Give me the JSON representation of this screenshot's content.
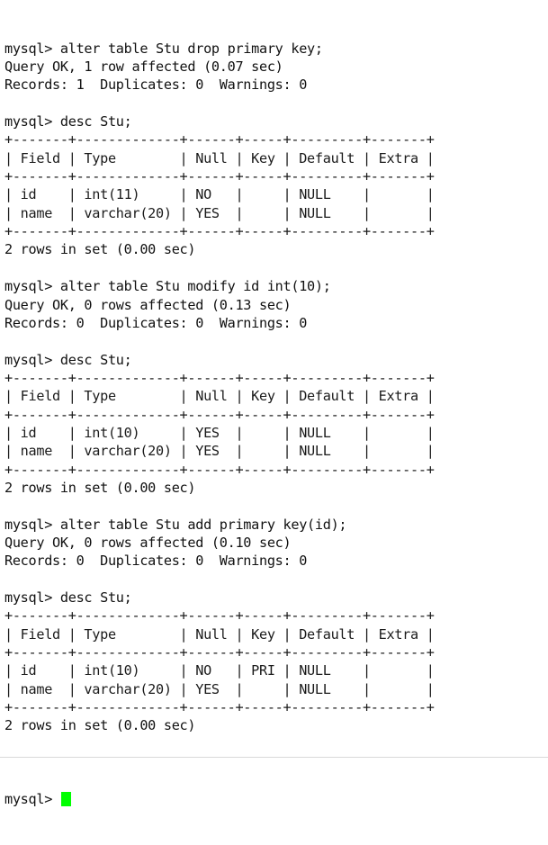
{
  "terminal": {
    "prompt": "mysql>",
    "cursor_color": "#00ff00",
    "background_color": "#ffffff",
    "text_color": "#111111",
    "lines": [
      "mysql> alter table Stu drop primary key;",
      "Query OK, 1 row affected (0.07 sec)",
      "Records: 1  Duplicates: 0  Warnings: 0",
      "",
      "mysql> desc Stu;",
      "+-------+-------------+------+-----+---------+-------+",
      "| Field | Type        | Null | Key | Default | Extra |",
      "+-------+-------------+------+-----+---------+-------+",
      "| id    | int(11)     | NO   |     | NULL    |       |",
      "| name  | varchar(20) | YES  |     | NULL    |       |",
      "+-------+-------------+------+-----+---------+-------+",
      "2 rows in set (0.00 sec)",
      "",
      "mysql> alter table Stu modify id int(10);",
      "Query OK, 0 rows affected (0.13 sec)",
      "Records: 0  Duplicates: 0  Warnings: 0",
      "",
      "mysql> desc Stu;",
      "+-------+-------------+------+-----+---------+-------+",
      "| Field | Type        | Null | Key | Default | Extra |",
      "+-------+-------------+------+-----+---------+-------+",
      "| id    | int(10)     | YES  |     | NULL    |       |",
      "| name  | varchar(20) | YES  |     | NULL    |       |",
      "+-------+-------------+------+-----+---------+-------+",
      "2 rows in set (0.00 sec)",
      "",
      "mysql> alter table Stu add primary key(id);",
      "Query OK, 0 rows affected (0.10 sec)",
      "Records: 0  Duplicates: 0  Warnings: 0",
      "",
      "mysql> desc Stu;",
      "+-------+-------------+------+-----+---------+-------+",
      "| Field | Type        | Null | Key | Default | Extra |",
      "+-------+-------------+------+-----+---------+-------+",
      "| id    | int(10)     | NO   | PRI | NULL    |       |",
      "| name  | varchar(20) | YES  |     | NULL    |       |",
      "+-------+-------------+------+-----+---------+-------+",
      "2 rows in set (0.00 sec)",
      ""
    ],
    "final_prompt": "mysql> "
  },
  "sessions": [
    {
      "command": "alter table Stu drop primary key;",
      "status": "Query OK, 1 row affected (0.07 sec)",
      "counters": "Records: 1  Duplicates: 0  Warnings: 0",
      "describe_command": "desc Stu;",
      "result_table": {
        "headers": [
          "Field",
          "Type",
          "Null",
          "Key",
          "Default",
          "Extra"
        ],
        "rows": [
          [
            "id",
            "int(11)",
            "NO",
            "",
            "NULL",
            ""
          ],
          [
            "name",
            "varchar(20)",
            "YES",
            "",
            "NULL",
            ""
          ]
        ],
        "footer": "2 rows in set (0.00 sec)"
      }
    },
    {
      "command": "alter table Stu modify id int(10);",
      "status": "Query OK, 0 rows affected (0.13 sec)",
      "counters": "Records: 0  Duplicates: 0  Warnings: 0",
      "describe_command": "desc Stu;",
      "result_table": {
        "headers": [
          "Field",
          "Type",
          "Null",
          "Key",
          "Default",
          "Extra"
        ],
        "rows": [
          [
            "id",
            "int(10)",
            "YES",
            "",
            "NULL",
            ""
          ],
          [
            "name",
            "varchar(20)",
            "YES",
            "",
            "NULL",
            ""
          ]
        ],
        "footer": "2 rows in set (0.00 sec)"
      }
    },
    {
      "command": "alter table Stu add primary key(id);",
      "status": "Query OK, 0 rows affected (0.10 sec)",
      "counters": "Records: 0  Duplicates: 0  Warnings: 0",
      "describe_command": "desc Stu;",
      "result_table": {
        "headers": [
          "Field",
          "Type",
          "Null",
          "Key",
          "Default",
          "Extra"
        ],
        "rows": [
          [
            "id",
            "int(10)",
            "NO",
            "PRI",
            "NULL",
            ""
          ],
          [
            "name",
            "varchar(20)",
            "YES",
            "",
            "NULL",
            ""
          ]
        ],
        "footer": "2 rows in set (0.00 sec)"
      }
    }
  ]
}
